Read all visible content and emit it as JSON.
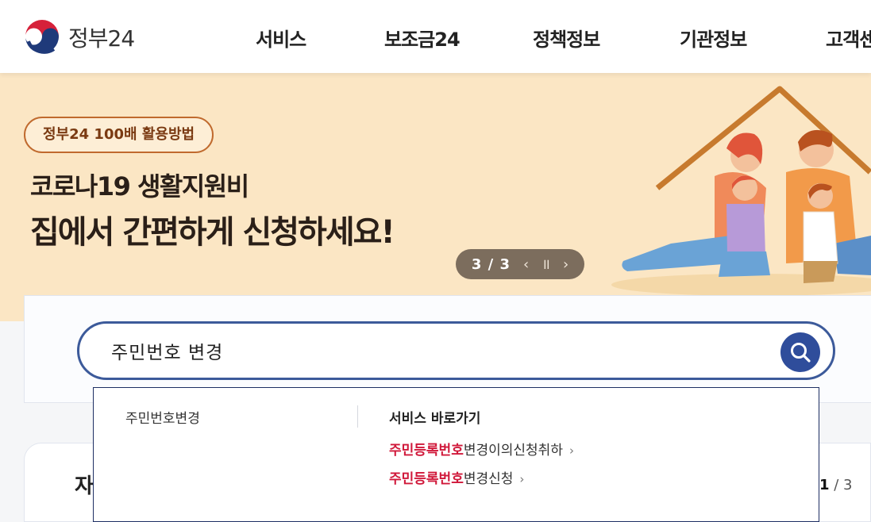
{
  "header": {
    "logo_text": "정부24",
    "nav": [
      {
        "label": "서비스"
      },
      {
        "label": "보조금24"
      },
      {
        "label": "정책정보"
      },
      {
        "label": "기관정보"
      },
      {
        "label": "고객센"
      }
    ]
  },
  "banner": {
    "pill_label": "정부24 100배 활용방법",
    "headline_1": "코로나19 생활지원비",
    "headline_2": "집에서 간편하게 신청하세요!",
    "slide_counter": "3 / 3",
    "prev_icon": "chevron-left-icon",
    "pause_icon": "pause-icon",
    "next_icon": "chevron-right-icon",
    "background_color": "#fbe6c4"
  },
  "search": {
    "value": "주민번호 변경",
    "button_icon": "search-icon",
    "accent_color": "#2f4d9b"
  },
  "autocomplete": {
    "suggestion": "주민번호변경",
    "shortcut_title": "서비스 바로가기",
    "shortcuts": [
      {
        "highlight": "주민등록번호",
        "rest": "변경이의신청취하",
        "arrow": "›"
      },
      {
        "highlight": "주민등록번호",
        "rest": "변경신청",
        "arrow": "›"
      }
    ],
    "highlight_color": "#d0183a"
  },
  "lower_section": {
    "title_fragment": "자",
    "pager_current": "1",
    "pager_total": " / 3"
  }
}
